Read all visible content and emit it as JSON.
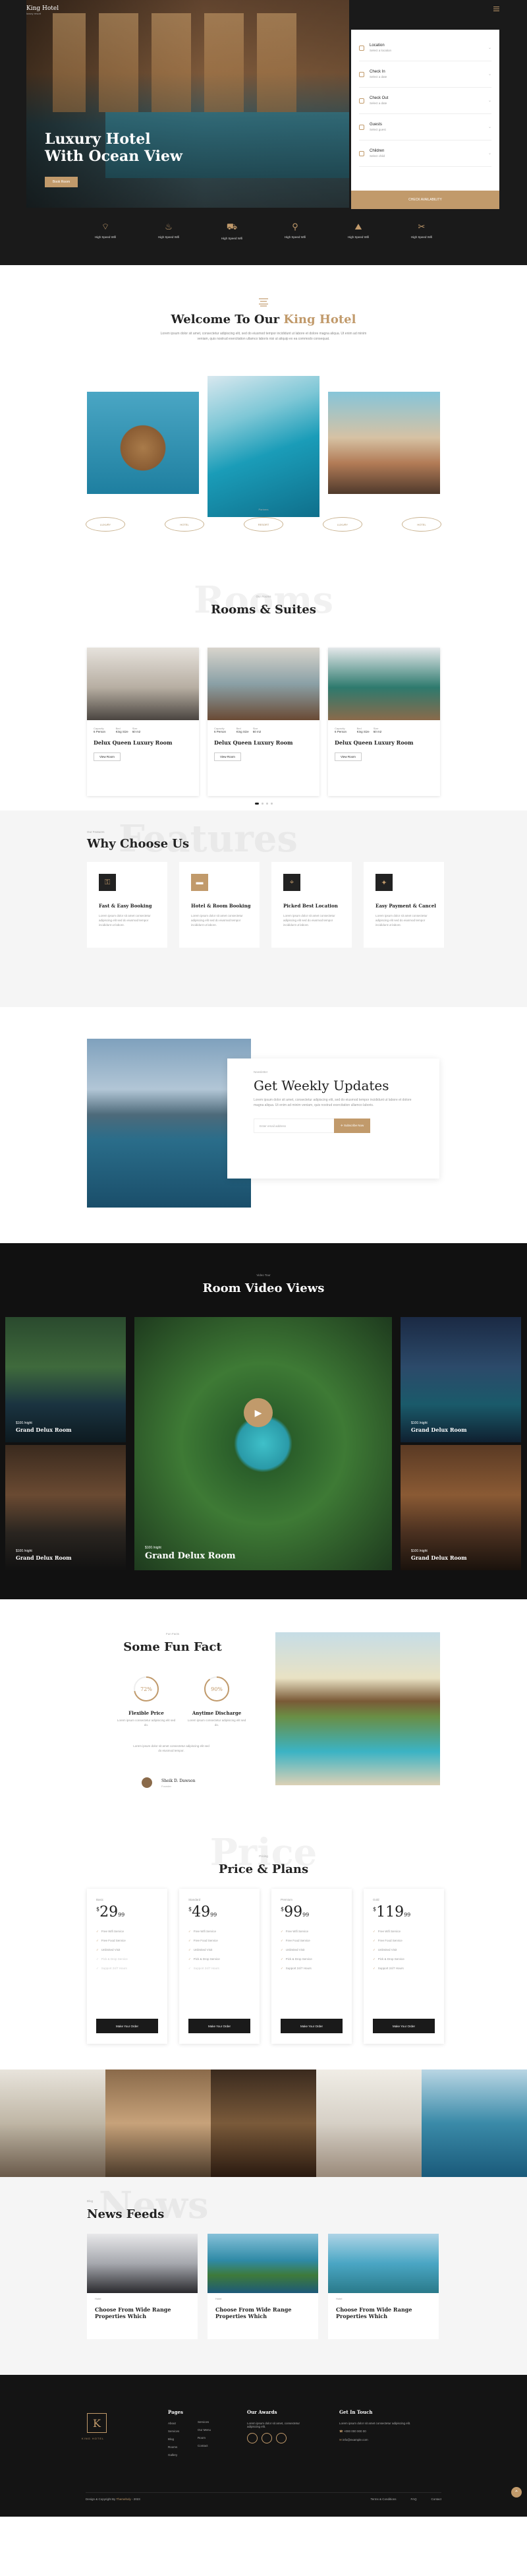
{
  "header": {
    "logo_name": "King Hotel",
    "logo_sub": "luxury resort"
  },
  "hero": {
    "title_line1": "Luxury Hotel",
    "title_line2": "With Ocean View",
    "cta": "Book Room",
    "booking": {
      "fields": [
        {
          "label": "Location",
          "value": "Select a location"
        },
        {
          "label": "Check In",
          "value": "Select a date"
        },
        {
          "label": "Check Out",
          "value": "Select a date"
        },
        {
          "label": "Guests",
          "value": "Select guest"
        },
        {
          "label": "Children",
          "value": "Select child"
        }
      ],
      "submit": "CHECK AVAILABILITY"
    },
    "amenities": [
      {
        "icon": "wifi-icon",
        "label": "High Speed Wifi"
      },
      {
        "icon": "spa-icon",
        "label": "High Speed Wifi"
      },
      {
        "icon": "car-icon",
        "label": "High Speed Wifi"
      },
      {
        "icon": "bike-icon",
        "label": "High Speed Wifi"
      },
      {
        "icon": "mountain-icon",
        "label": "High Speed Wifi"
      },
      {
        "icon": "dining-icon",
        "label": "High Speed Wifi"
      }
    ]
  },
  "welcome": {
    "title_plain": "Welcome To Our",
    "title_accent": "King Hotel",
    "text": "Lorem ipsum dolor sit amet, consectetur adipiscing elit, sed do eiusmod tempor incididunt ut labore et dolore magna aliqua. Ut enim ad minim veniam, quis nostrud exercitation ullamco laboris nisi ut aliquip ex ea commodo consequat.",
    "partners_tag": "Partners",
    "partners": [
      "LUXURY",
      "HOTEL",
      "RESORT",
      "LUXURY",
      "HOTEL"
    ]
  },
  "rooms": {
    "ghost": "Rooms",
    "tag": "Our Rooms",
    "title": "Rooms & Suites",
    "spec_labels": [
      "Capacity",
      "Bed",
      "Size"
    ],
    "items": [
      {
        "name": "Delux Queen Luxury Room",
        "capacity": "6 Person",
        "bed": "King Size",
        "size": "60 m2",
        "button": "View Room"
      },
      {
        "name": "Delux Queen Luxury Room",
        "capacity": "6 Person",
        "bed": "King Size",
        "size": "60 m2",
        "button": "View Room"
      },
      {
        "name": "Delux Queen Luxury Room",
        "capacity": "6 Person",
        "bed": "King Size",
        "size": "60 m2",
        "button": "View Room"
      }
    ]
  },
  "why": {
    "ghost": "Features",
    "tag": "Our Features",
    "title": "Why Choose Us",
    "items": [
      {
        "icon": "key-icon",
        "title": "Fast & Easy Booking",
        "text": "Lorem ipsum dolor sit amet consectetur adipiscing elit sed do eiusmod tempor incididunt ut labore."
      },
      {
        "icon": "bed-icon",
        "title": "Hotel & Room Booking",
        "text": "Lorem ipsum dolor sit amet consectetur adipiscing elit sed do eiusmod tempor incididunt ut labore."
      },
      {
        "icon": "location-icon",
        "title": "Picked Best Location",
        "text": "Lorem ipsum dolor sit amet consectetur adipiscing elit sed do eiusmod tempor incididunt ut labore."
      },
      {
        "icon": "payment-icon",
        "title": "Easy Payment & Cancel",
        "text": "Lorem ipsum dolor sit amet consectetur adipiscing elit sed do eiusmod tempor incididunt ut labore."
      }
    ]
  },
  "updates": {
    "tag": "Newsletter",
    "title": "Get Weekly Updates",
    "text": "Lorem ipsum dolor sit amet, consectetur adipiscing elit, sed do eiusmod tempor incididunt ut labore et dolore magna aliqua. Ut enim ad minim veniam, quis nostrud exercitation ullamco laboris.",
    "placeholder": "Enter email address",
    "button": "Subscribe Now"
  },
  "videos": {
    "tag": "Video Tour",
    "title": "Room Video Views",
    "items": [
      {
        "price": "$100 /night",
        "name": "Grand Delux Room"
      },
      {
        "price": "$100 /night",
        "name": "Grand Delux Room"
      },
      {
        "price": "$100 /night",
        "name": "Grand Delux Room"
      },
      {
        "price": "$100 /night",
        "name": "Grand Delux Room"
      },
      {
        "price": "$100 /night",
        "name": "Grand Delux Room"
      }
    ]
  },
  "fun": {
    "tag": "Fun Facts",
    "title": "Some Fun Fact",
    "facts": [
      {
        "percent": "72%",
        "value": 0.72,
        "title": "Flexible Price",
        "text": "Lorem ipsum consectetur adipisicing elit sed do."
      },
      {
        "percent": "90%",
        "value": 0.9,
        "title": "Anytime Discharge",
        "text": "Lorem ipsum consectetur adipisicing elit sed do."
      }
    ],
    "note": "Lorem ipsum dolor sit amet consectetur adipiscing elit sed do eiusmod tempor.",
    "author_name": "Sheik D. Dawson",
    "author_role": "Founder"
  },
  "prices": {
    "ghost": "Price",
    "tag": "Pricing",
    "title": "Price & Plans",
    "features": [
      "Free Wifi Service",
      "Free Food Service",
      "Unlimited Visit",
      "Pick & Drop Service",
      "Support 24/7 Hours"
    ],
    "button": "Make Your Order",
    "plans": [
      {
        "name": "Basic",
        "dollars": "29",
        "cents": "99",
        "enabled": [
          true,
          true,
          true,
          false,
          false
        ]
      },
      {
        "name": "Standard",
        "dollars": "49",
        "cents": "99",
        "enabled": [
          true,
          true,
          true,
          true,
          false
        ]
      },
      {
        "name": "Premium",
        "dollars": "99",
        "cents": "99",
        "enabled": [
          true,
          true,
          true,
          true,
          true
        ]
      },
      {
        "name": "Gold",
        "dollars": "119",
        "cents": "99",
        "enabled": [
          true,
          true,
          true,
          true,
          true
        ]
      }
    ]
  },
  "news": {
    "ghost": "News",
    "tag": "Blog",
    "title": "News Feeds",
    "items": [
      {
        "cat": "Hotel",
        "title": "Choose From Wide Range Properties Which"
      },
      {
        "cat": "Hotel",
        "title": "Choose From Wide Range Properties Which"
      },
      {
        "cat": "Hotel",
        "title": "Choose From Wide Range Properties Which"
      }
    ]
  },
  "footer": {
    "brand": "KING HOTEL",
    "pages_title": "Pages",
    "pages": [
      "About",
      "Services",
      "Blog",
      "Rooms",
      "Gallery"
    ],
    "pages2": [
      "Services",
      "Our Menu",
      "Room",
      "Contact"
    ],
    "awards_title": "Our Awards",
    "awards_text": "Lorem ipsum dolor sit amet, consectetur adipiscing elit.",
    "contact_title": "Get In Touch",
    "contact_text": "Lorem ipsum dolor sit amet consectetur adipiscing elit.",
    "phone": "+000 000 000 00",
    "email": "info@example.com",
    "copyright_prefix": "Design & Copyright By",
    "copyright_brand": "Themeholy",
    "copyright_year": "2023",
    "links": [
      "Terms & Conditions",
      "FAQ",
      "Contact"
    ]
  },
  "colors": {
    "accent": "#c19a6b",
    "dark": "#141414"
  }
}
